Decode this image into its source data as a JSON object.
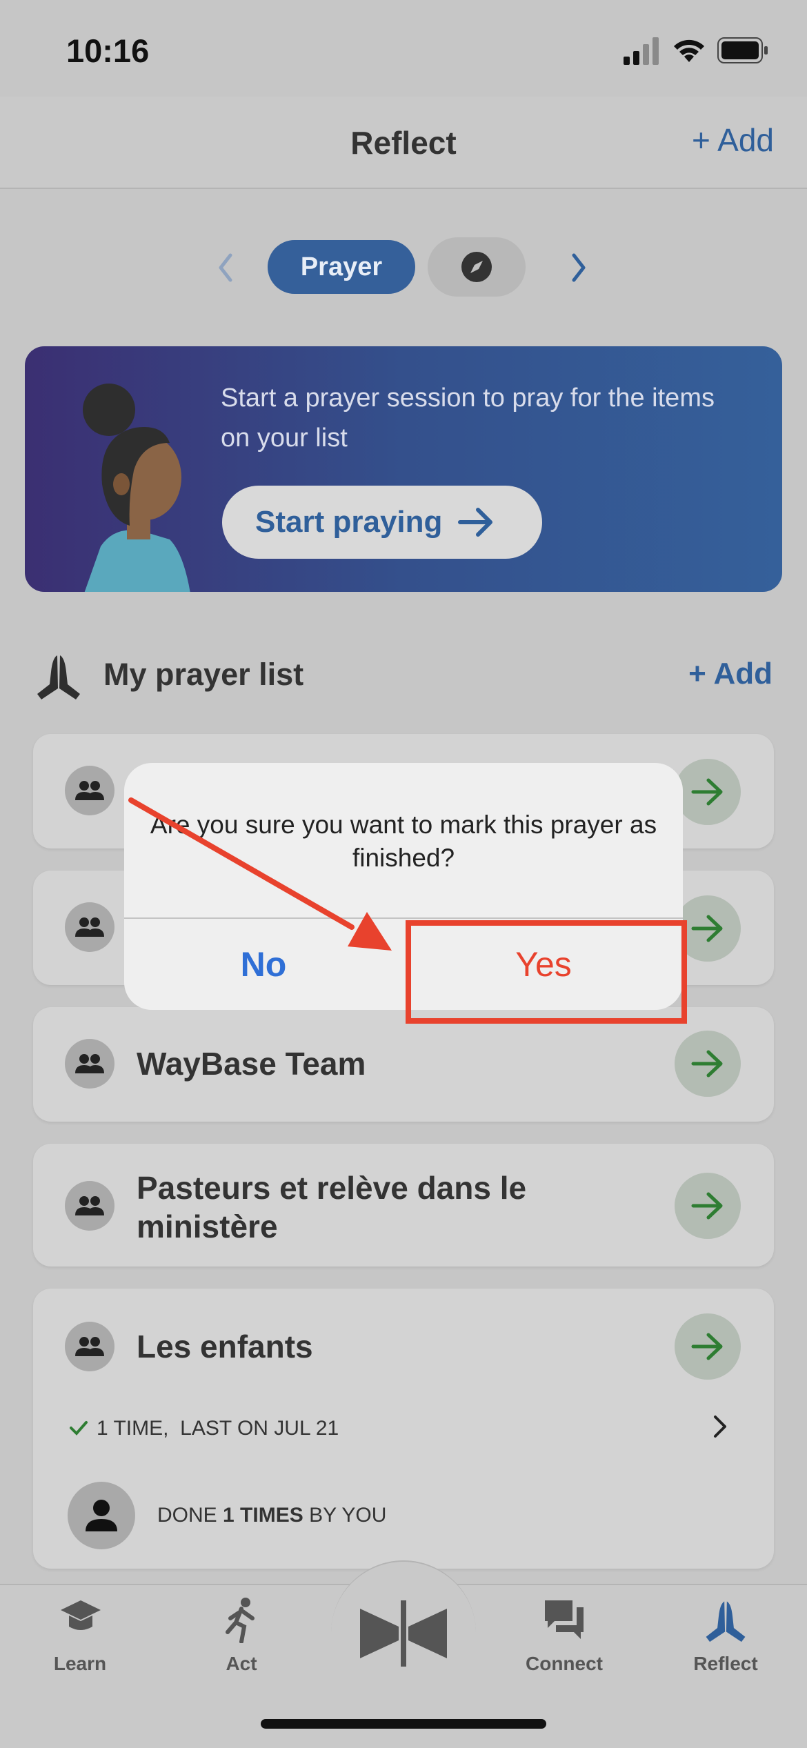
{
  "status": {
    "time": "10:16"
  },
  "header": {
    "title": "Reflect",
    "add_label": "+ Add"
  },
  "segment": {
    "active_label": "Prayer"
  },
  "banner": {
    "text": "Start a prayer session to pray for the items on your list",
    "button_label": "Start praying"
  },
  "section": {
    "title": "My prayer list",
    "add_label": "+ Add"
  },
  "cards": [
    {
      "title": "WayBase Team"
    },
    {
      "title": "Pasteurs et relève dans le ministère"
    },
    {
      "title": "Les enfants",
      "stats": "1 TIME,  LAST ON JUL 21",
      "done_prefix": "DONE",
      "done_count": "1 TIMES",
      "done_suffix": "BY YOU"
    }
  ],
  "dialog": {
    "message": "Are you sure you want to mark this prayer as finished?",
    "no_label": "No",
    "yes_label": "Yes"
  },
  "tabs": [
    {
      "label": "Learn",
      "icon": "graduation-cap-icon"
    },
    {
      "label": "Act",
      "icon": "running-person-icon"
    },
    {
      "label": "",
      "icon": "waybase-logo-icon"
    },
    {
      "label": "Connect",
      "icon": "chat-bubbles-icon"
    },
    {
      "label": "Reflect",
      "icon": "praying-hands-icon"
    }
  ],
  "colors": {
    "accent": "#2f5f9a",
    "danger": "#e8422d",
    "link": "#2f6fd6",
    "arrow_green": "#2e7d32"
  }
}
